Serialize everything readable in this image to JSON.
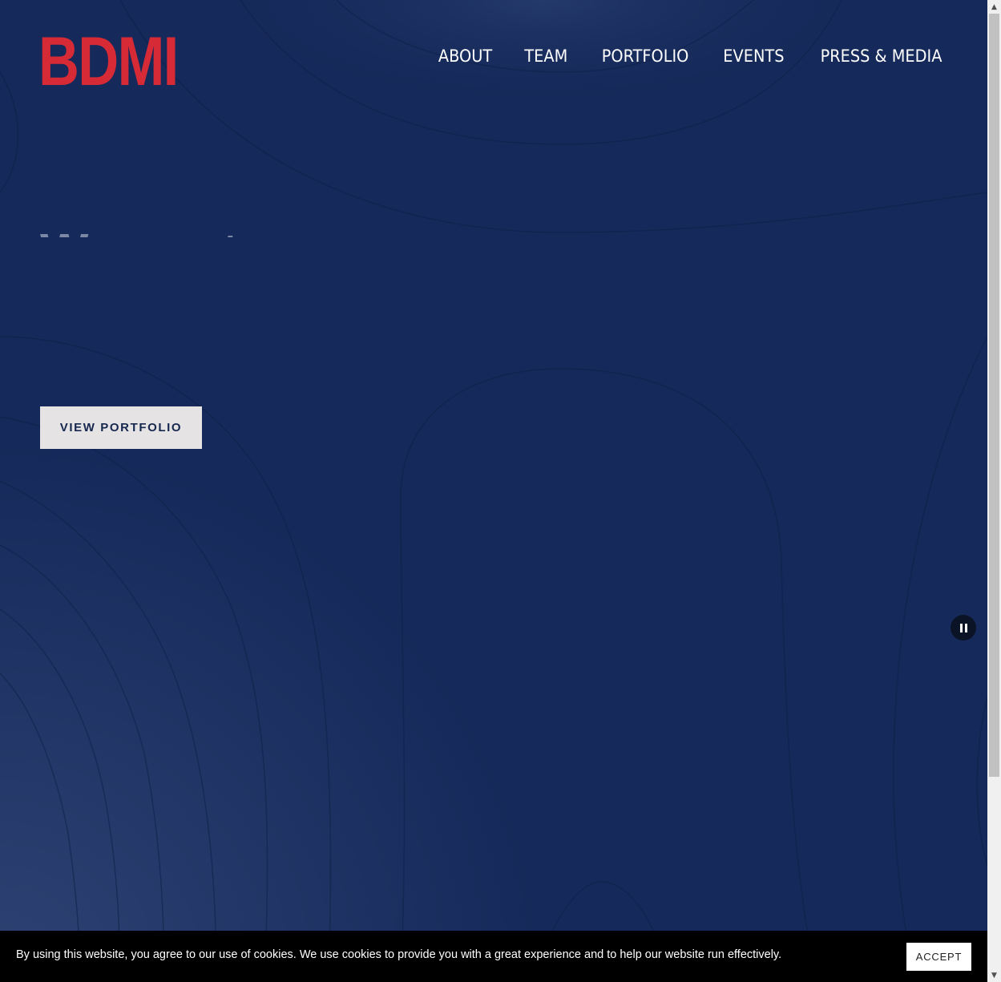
{
  "brand": {
    "logo_text": "BDMI",
    "logo_color": "#d62b36"
  },
  "nav": {
    "items": [
      {
        "label": "ABOUT"
      },
      {
        "label": "TEAM"
      },
      {
        "label": "PORTFOLIO"
      },
      {
        "label": "EVENTS"
      },
      {
        "label": "PRESS & MEDIA"
      }
    ]
  },
  "hero": {
    "headline_partial": "We are t",
    "cta_label": "VIEW PORTFOLIO",
    "background_color": "#15295a"
  },
  "video_control": {
    "icon": "pause-icon"
  },
  "cookie_banner": {
    "message": "By using this website, you agree to our use of cookies. We use cookies to provide you with a great experience and to help our website run effectively.",
    "accept_label": "ACCEPT"
  }
}
